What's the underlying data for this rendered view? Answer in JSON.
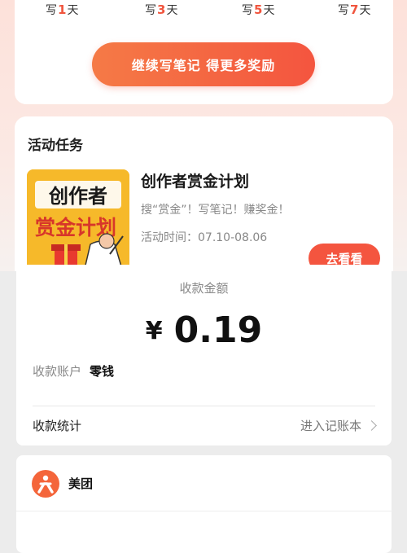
{
  "rewards": {
    "days": [
      {
        "prefix": "写",
        "number": "1",
        "suffix": "天"
      },
      {
        "prefix": "写",
        "number": "3",
        "suffix": "天"
      },
      {
        "prefix": "写",
        "number": "5",
        "suffix": "天"
      },
      {
        "prefix": "写",
        "number": "7",
        "suffix": "天"
      }
    ],
    "continue_label": "继续写笔记 得更多奖励"
  },
  "activity": {
    "section_title": "活动任务",
    "thumbnail_text_line1": "创作者",
    "thumbnail_text_line2": "赏金计划",
    "name": "创作者赏金计划",
    "description": "搜“赏金”！写笔记！赚奖金！",
    "time": "活动时间：07.10-08.06",
    "go_label": "去看看"
  },
  "payment": {
    "amount_label": "收款金额",
    "currency": "¥",
    "amount": "0.19",
    "account_label": "收款账户",
    "account_value": "零钱",
    "stats_label": "收款统计",
    "stats_link": "进入记账本"
  },
  "merchant": {
    "name": "美团",
    "icon": "meituan-icon",
    "brand_color": "#f4653a"
  },
  "colors": {
    "accent": "#f4553f",
    "button_gradient_start": "#f57a46"
  }
}
